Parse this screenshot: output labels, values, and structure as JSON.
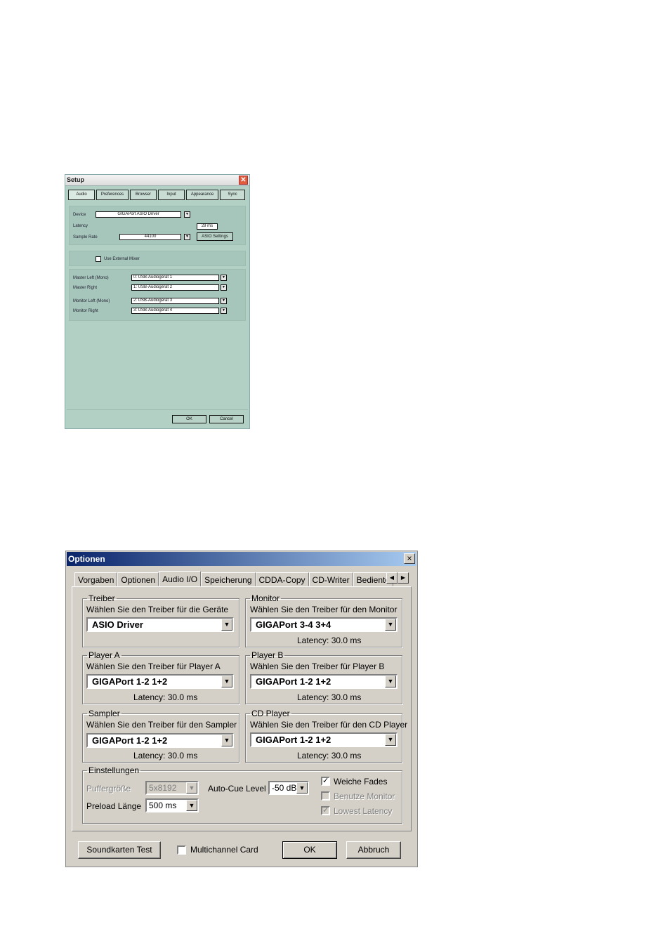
{
  "setup": {
    "title": "Setup",
    "close_glyph": "✕",
    "tabs": [
      "Audio",
      "Preferences",
      "Browser",
      "Input",
      "Appearance",
      "Sync"
    ],
    "device_label": "Device",
    "device_value": "GIGAPort ASIO Driver",
    "latency_label": "Latency",
    "latency_value": "29 ms",
    "sample_rate_label": "Sample Rate",
    "sample_rate_value": "44100",
    "asio_settings": "ASIO Settings",
    "use_external_mixer": "Use External Mixer",
    "master_left_label": "Master Left (Mono)",
    "master_left_value": "0: USB-Audiogerät 1",
    "master_right_label": "Master Right",
    "master_right_value": "1: USB-Audiogerät 2",
    "monitor_left_label": "Monitor Left (Mono)",
    "monitor_left_value": "2: USB-Audiogerät 3",
    "monitor_right_label": "Monitor Right",
    "monitor_right_value": "3: USB-Audiogerät 4",
    "ok": "OK",
    "cancel": "Cancel"
  },
  "optionen": {
    "title": "Optionen",
    "close_glyph": "×",
    "tabs": [
      "Vorgaben",
      "Optionen",
      "Audio I/O",
      "Speicherung",
      "CDDA-Copy",
      "CD-Writer",
      "Bedienteil"
    ],
    "arrow_left": "◀",
    "arrow_right": "▶",
    "treiber": {
      "legend": "Treiber",
      "desc": "Wählen Sie den Treiber für die Geräte",
      "value": "ASIO Driver"
    },
    "monitor": {
      "legend": "Monitor",
      "desc": "Wählen Sie den Treiber für den Monitor",
      "value": "GIGAPort 3-4 3+4",
      "latency": "Latency: 30.0 ms"
    },
    "player_a": {
      "legend": "Player A",
      "desc": "Wählen Sie den Treiber für Player A",
      "value": "GIGAPort 1-2 1+2",
      "latency": "Latency: 30.0 ms"
    },
    "player_b": {
      "legend": "Player B",
      "desc": "Wählen Sie den Treiber für Player B",
      "value": "GIGAPort 1-2 1+2",
      "latency": "Latency: 30.0 ms"
    },
    "sampler": {
      "legend": "Sampler",
      "desc": "Wählen Sie den Treiber für den Sampler",
      "value": "GIGAPort 1-2 1+2",
      "latency": "Latency: 30.0 ms"
    },
    "cd_player": {
      "legend": "CD Player",
      "desc": "Wählen Sie den Treiber für den CD Player",
      "value": "GIGAPort 1-2 1+2",
      "latency": "Latency: 30.0 ms"
    },
    "einstellungen": {
      "legend": "Einstellungen",
      "puffer_label": "Puffergröße",
      "puffer_value": "5x8192",
      "preload_label": "Preload Länge",
      "preload_value": "500 ms",
      "autocue_label": "Auto-Cue Level",
      "autocue_value": "-50 dB",
      "weiche_fades": "Weiche Fades",
      "benutze_monitor": "Benutze Monitor",
      "lowest_latency": "Lowest Latency",
      "check_glyph": "✓"
    },
    "soundkarten_test": "Soundkarten Test",
    "multichannel_card": "Multichannel Card",
    "ok": "OK",
    "abbruch": "Abbruch"
  }
}
